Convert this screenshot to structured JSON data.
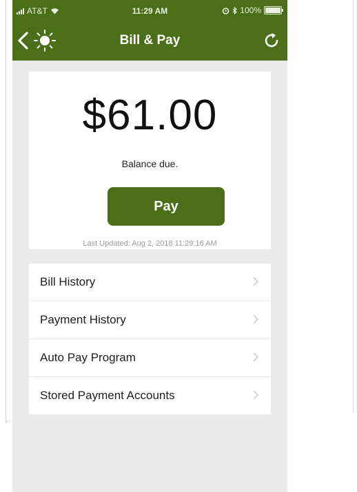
{
  "status_bar": {
    "carrier": "AT&T",
    "time": "11:29 AM",
    "battery": "100%"
  },
  "nav": {
    "title": "Bill & Pay",
    "icons": [
      "back-chevron-icon",
      "sun-logo-icon",
      "refresh-icon"
    ]
  },
  "balance": {
    "amount": "$61.00",
    "label": "Balance due.",
    "pay_label": "Pay",
    "last_updated": "Last Updated: Aug 2, 2018 11:29:16 AM"
  },
  "menu": {
    "items": [
      {
        "label": "Bill History"
      },
      {
        "label": "Payment History"
      },
      {
        "label": "Auto Pay Program"
      },
      {
        "label": "Stored Payment Accounts"
      }
    ]
  },
  "colors": {
    "brand_green": "#4b6f18",
    "background": "#ebebeb",
    "card": "#ffffff"
  }
}
